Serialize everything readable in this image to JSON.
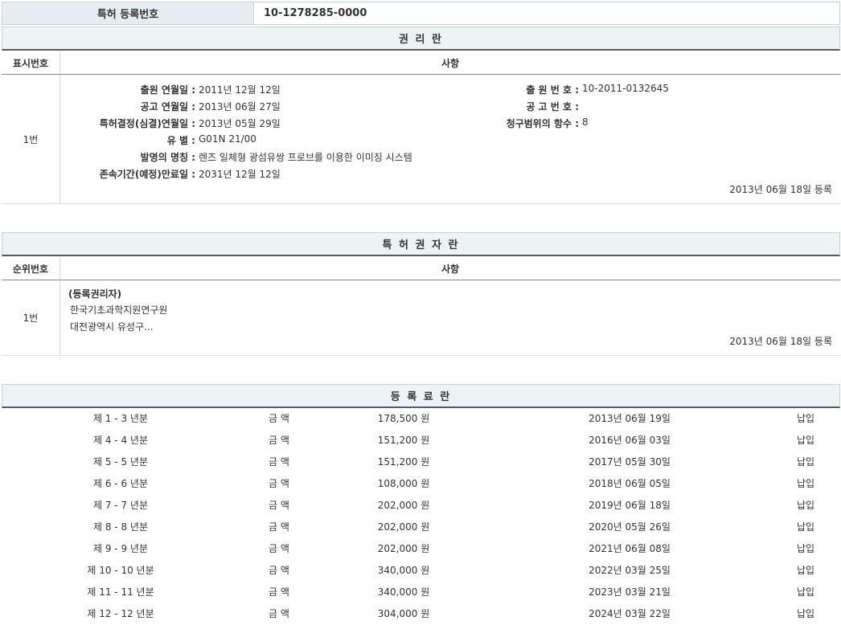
{
  "registration": {
    "label": "특허 등록번호",
    "number": "10-1278285-0000"
  },
  "rights": {
    "title": "권 리 란",
    "col_num": "표시번호",
    "col_detail": "사항",
    "entry_num": "1번",
    "left_fields": [
      {
        "label": "출원 연월일 :",
        "value": "2011년 12월 12일"
      },
      {
        "label": "공고 연월일 :",
        "value": "2013년 06월 27일"
      },
      {
        "label": "특허결정(심결)연월일 :",
        "value": "2013년 05월 29일"
      },
      {
        "label": "유  별 :",
        "value": "G01N 21/00"
      },
      {
        "label": "발명의 명칭 :",
        "value": "렌즈 일체형 광섬유쌍 프로브를 이용한 이미징 시스템"
      },
      {
        "label": "존속기간(예정)만료일 :",
        "value": "2031년 12월 12일"
      }
    ],
    "right_fields": [
      {
        "label": "출 원 번 호 :",
        "value": "10-2011-0132645"
      },
      {
        "label": "공 고 번 호 :",
        "value": ""
      },
      {
        "label": "청구범위의 항수 :",
        "value": "8"
      }
    ],
    "registered": "2013년 06월 18일 등록"
  },
  "holders": {
    "title": "특 허 권 자 란",
    "col_num": "순위번호",
    "col_detail": "사항",
    "entry_num": "1번",
    "role": "(등록권리자)",
    "name": "한국기초과학지원연구원",
    "address": "대전광역시 유성구...",
    "registered": "2013년 06월 18일 등록"
  },
  "fees": {
    "title": "등 록 료 란",
    "rows": [
      {
        "period": "제 1 - 3 년분",
        "kind": "금 액",
        "amount": "178,500 원",
        "date": "2013년 06월 19일",
        "status": "납입"
      },
      {
        "period": "제 4 - 4 년분",
        "kind": "금 액",
        "amount": "151,200 원",
        "date": "2016년 06월 03일",
        "status": "납입"
      },
      {
        "period": "제 5 - 5 년분",
        "kind": "금 액",
        "amount": "151,200 원",
        "date": "2017년 05월 30일",
        "status": "납입"
      },
      {
        "period": "제 6 - 6 년분",
        "kind": "금 액",
        "amount": "108,000 원",
        "date": "2018년 06월 05일",
        "status": "납입"
      },
      {
        "period": "제 7 - 7 년분",
        "kind": "금 액",
        "amount": "202,000 원",
        "date": "2019년 06월 18일",
        "status": "납입"
      },
      {
        "period": "제 8 - 8 년분",
        "kind": "금 액",
        "amount": "202,000 원",
        "date": "2020년 05월 26일",
        "status": "납입"
      },
      {
        "period": "제 9 - 9 년분",
        "kind": "금 액",
        "amount": "202,000 원",
        "date": "2021년 06월 08일",
        "status": "납입"
      },
      {
        "period": "제 10 - 10 년분",
        "kind": "금 액",
        "amount": "340,000 원",
        "date": "2022년 03월 25일",
        "status": "납입"
      },
      {
        "period": "제 11 - 11 년분",
        "kind": "금 액",
        "amount": "340,000 원",
        "date": "2023년 03월 21일",
        "status": "납입"
      },
      {
        "period": "제 12 - 12 년분",
        "kind": "금 액",
        "amount": "304,000 원",
        "date": "2024년 03월 22일",
        "status": "납입"
      }
    ]
  }
}
